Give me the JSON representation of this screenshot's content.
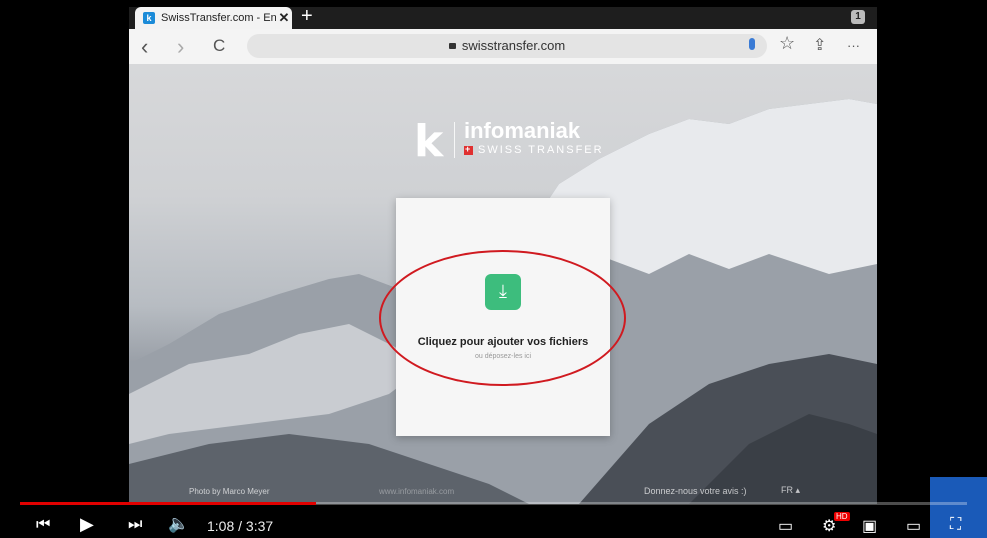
{
  "browser": {
    "tab_title": "SwissTransfer.com - Envoi",
    "tab_favicon": "k",
    "tab_close": "✕",
    "new_tab": "+",
    "tab_count": "1",
    "url": "swisstransfer.com",
    "icons": {
      "back": "‹",
      "forward": "›",
      "reload": "C",
      "bookmark": "☆",
      "share": "⇪",
      "more": "···"
    }
  },
  "page": {
    "brand_letter": "k",
    "brand_name": "infomaniak",
    "brand_sub": "SWISS TRANSFER",
    "upload_icon": "⤓",
    "cta_title": "Cliquez pour ajouter vos fichiers",
    "cta_sub": "ou déposez-les ici",
    "photo_credit": "Photo by Marco Meyer",
    "footer_site": "www.infomaniak.com",
    "feedback": "Donnez-nous votre avis :)",
    "lang": "FR ▴"
  },
  "player": {
    "time_current": "1:08",
    "time_total": "3:37",
    "time_display": "1:08 / 3:37",
    "progress": 0.313,
    "hd_badge": "HD"
  },
  "colors": {
    "accent_red": "#d01a20",
    "progress": "#e10000",
    "upload_green": "#3dbd7d"
  }
}
